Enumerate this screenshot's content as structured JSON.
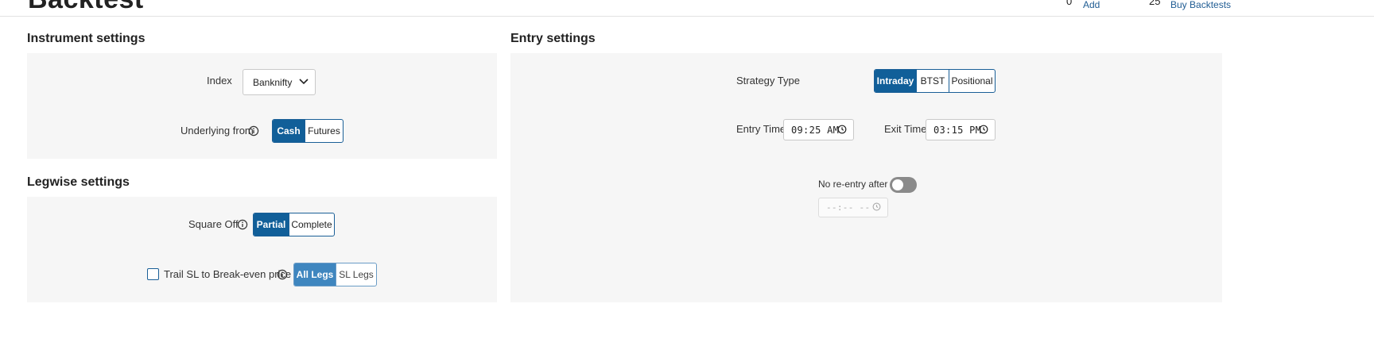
{
  "page": {
    "title": "Backtest"
  },
  "header": {
    "add_count": "0",
    "add_label": "Add",
    "backtests_count": "25",
    "buy_label": "Buy Backtests"
  },
  "instrument": {
    "heading": "Instrument settings",
    "index_label": "Index",
    "index_value": "Banknifty",
    "underlying_label": "Underlying from",
    "underlying_options": [
      "Cash",
      "Futures"
    ],
    "underlying_selected": "Cash"
  },
  "legwise": {
    "heading": "Legwise settings",
    "square_off_label": "Square Off",
    "square_off_options": [
      "Partial",
      "Complete"
    ],
    "square_off_selected": "Partial",
    "trail_label": "Trail SL to Break-even price",
    "trail_checked": false,
    "trail_options": [
      "All Legs",
      "SL Legs"
    ],
    "trail_selected": "All Legs"
  },
  "entry": {
    "heading": "Entry settings",
    "strategy_label": "Strategy Type",
    "strategy_options": [
      "Intraday",
      "BTST",
      "Positional"
    ],
    "strategy_selected": "Intraday",
    "entry_time_label": "Entry Time",
    "entry_time_value": "09:25 AM",
    "exit_time_label": "Exit Time",
    "exit_time_value": "03:15 PM",
    "no_reentry_label": "No re-entry after",
    "no_reentry_enabled": false,
    "no_reentry_time_placeholder": "--:-- --"
  },
  "colors": {
    "primary": "#115f99",
    "primary_light": "#3f86bf",
    "panel_bg": "#f6f6f6",
    "link": "#1f5c93",
    "toggle_off": "#8a8a8a"
  },
  "icons": [
    "info-icon",
    "chevron-down-icon",
    "clock-icon",
    "checkbox-icon",
    "toggle-switch"
  ]
}
